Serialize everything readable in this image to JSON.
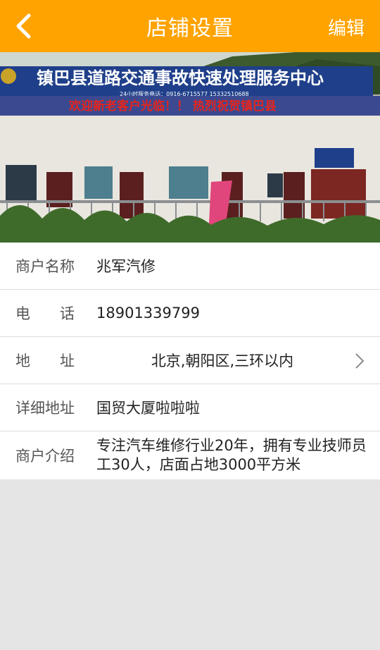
{
  "header": {
    "title": "店铺设置",
    "edit_label": "编辑"
  },
  "banner": {
    "sign_main": "镇巴县道路交通事故快速处理服务中心",
    "sign_phone": "24小时服务电话：0916-6715577 15332510688",
    "led_text": "欢迎新老客户光临！！ 热烈祝贺镇巴县",
    "sign_main_color": "#1f3f8a",
    "led_color": "#e5251f"
  },
  "fields": [
    {
      "label": "商户名称",
      "value": "兆军汽修"
    },
    {
      "label": "电　　话",
      "value": "18901339799"
    },
    {
      "label": "地　　址",
      "value": "北京,朝阳区,三环以内"
    },
    {
      "label": "详细地址",
      "value": "国贸大厦啦啦啦"
    },
    {
      "label": "商户介绍",
      "value": "专注汽车维修行业20年，拥有专业技师员工30人，店面占地3000平方米"
    }
  ],
  "colors": {
    "accent": "#ffa300",
    "background": "#e5e5e5"
  },
  "icons": {
    "back": "chevron-left-icon",
    "address_arrow": "chevron-right-icon"
  }
}
